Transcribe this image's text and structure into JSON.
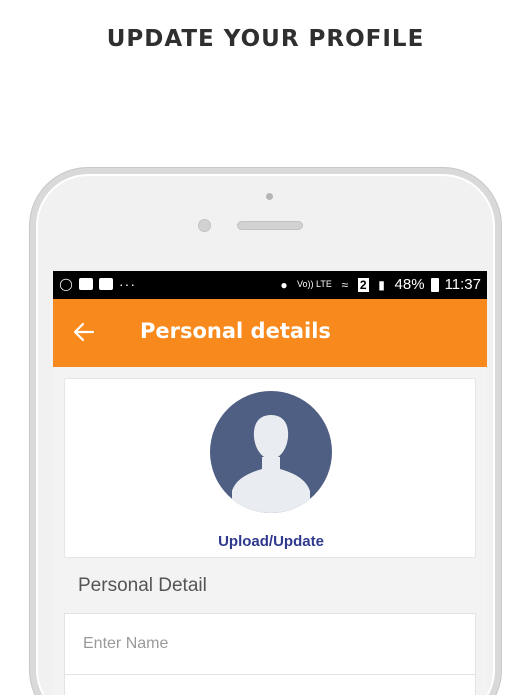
{
  "headline": "UPDATE YOUR PROFILE",
  "status_bar": {
    "network": "Vo)) LTE",
    "sim": "2",
    "battery": "48%",
    "time": "11:37"
  },
  "app_bar": {
    "title": "Personal details",
    "color": "#f7891d"
  },
  "profile_card": {
    "upload_label": "Upload/Update"
  },
  "section": {
    "heading": "Personal Detail"
  },
  "form": {
    "name_placeholder": "Enter Name",
    "name_value": ""
  },
  "icons": [
    "back-arrow-icon",
    "avatar-placeholder-icon",
    "wifi-icon",
    "signal-icon",
    "battery-icon",
    "gmail-icon",
    "gallery-icon"
  ]
}
